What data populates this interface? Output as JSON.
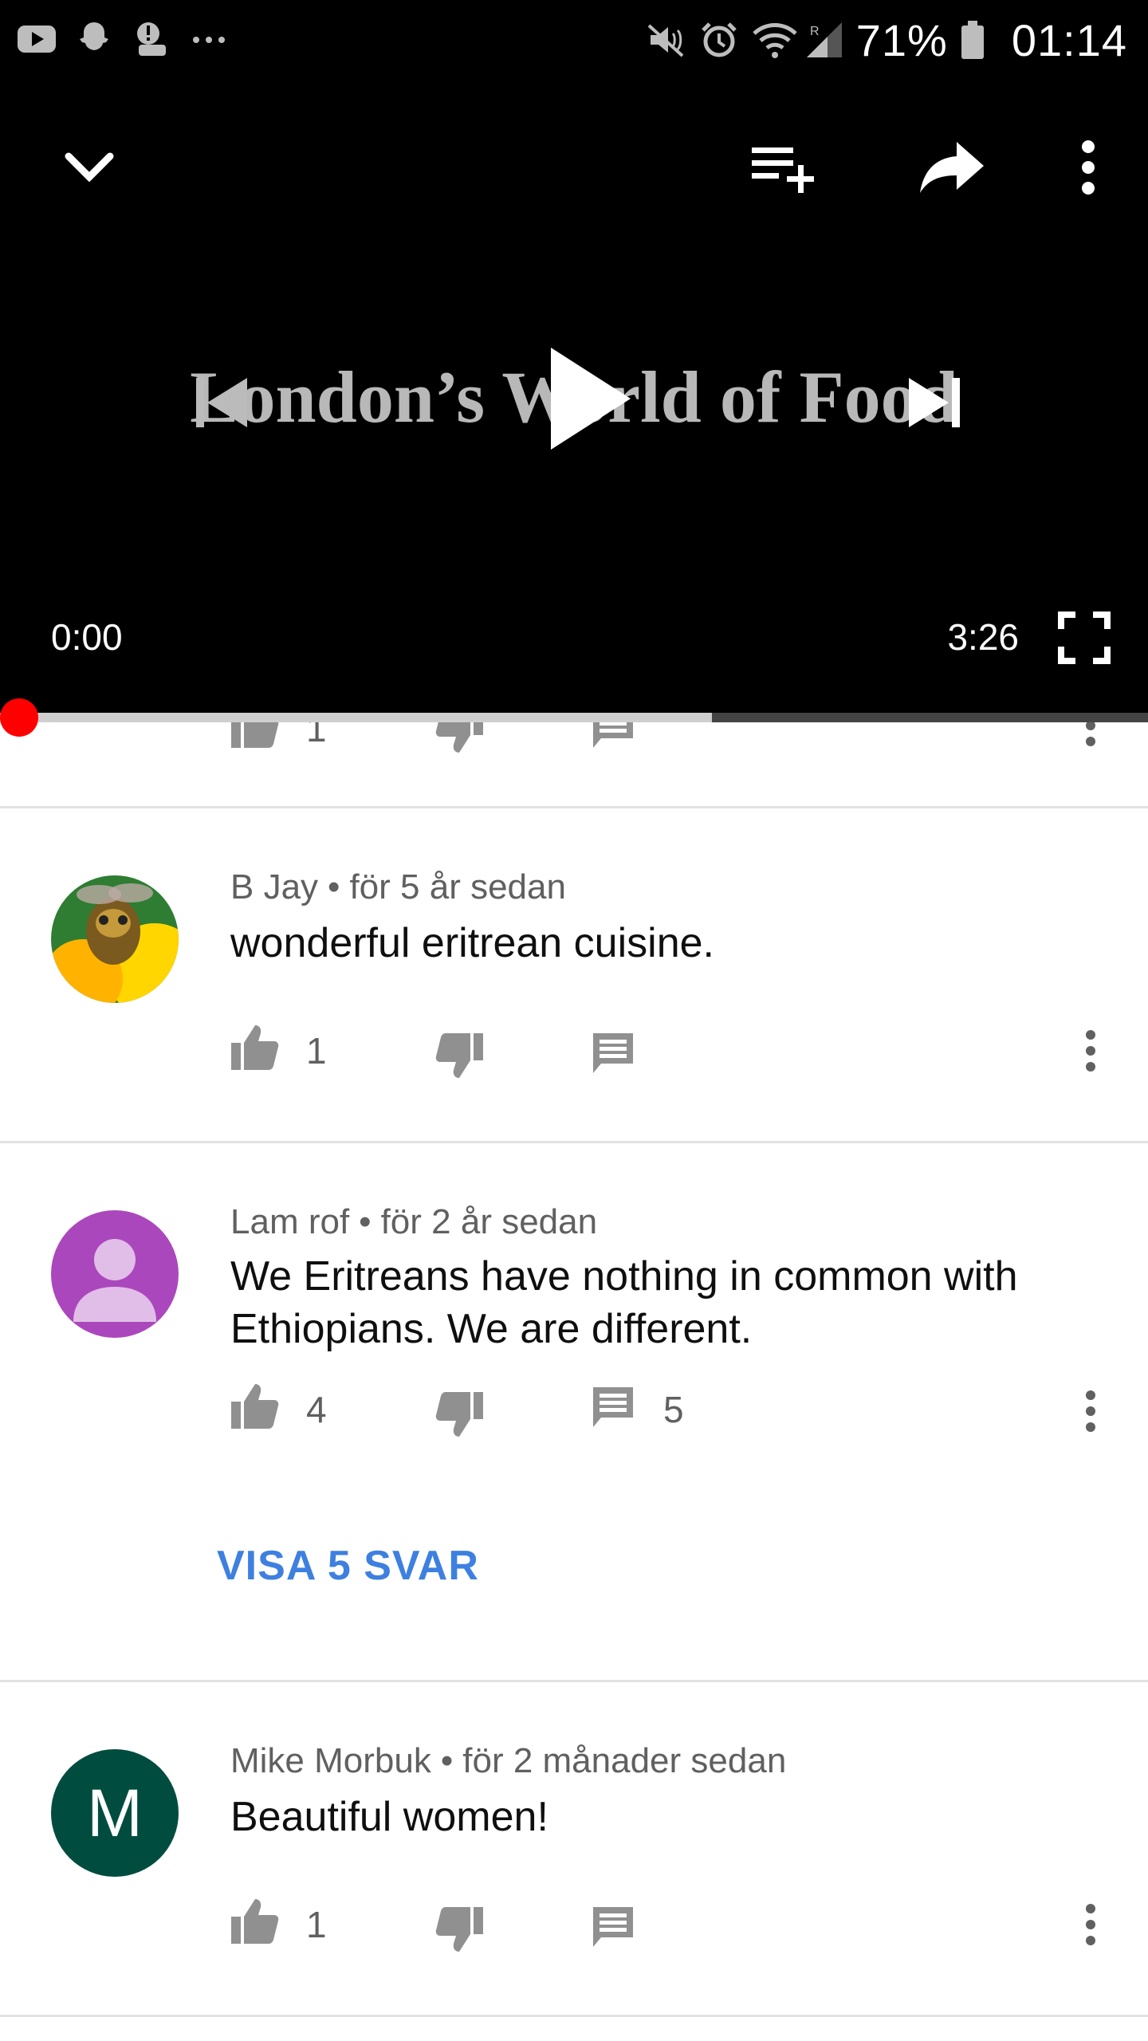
{
  "status_bar": {
    "left_icons": [
      "youtube-icon",
      "snapchat-icon",
      "notification-alert-icon",
      "more-notifications-icon"
    ],
    "right_icons": [
      "mute-icon",
      "alarm-icon",
      "wifi-icon",
      "signal-icon",
      "battery-icon"
    ],
    "battery": "71%",
    "time": "01:14"
  },
  "player": {
    "video_title_overlay": "London’s World of Food",
    "current_time": "0:00",
    "duration": "3:26",
    "progress_fraction": 0.0,
    "buffer_fraction": 0.62,
    "icons": [
      "collapse-chevron-icon",
      "add-to-queue-icon",
      "share-icon",
      "more-vert-icon",
      "previous-icon",
      "play-icon",
      "next-icon",
      "fullscreen-icon"
    ]
  },
  "comments": [
    {
      "author": "",
      "time": "",
      "text": "",
      "likes": "1",
      "replies_count": "",
      "partial": true
    },
    {
      "author": "B Jay",
      "time": "för 5 år sedan",
      "text": "wonderful eritrean cuisine.",
      "likes": "1",
      "replies_count": "",
      "avatar_type": "photo"
    },
    {
      "author": "Lam rof",
      "time": "för 2 år sedan",
      "text": "We Eritreans have nothing in common with Ethiopians.  We are different.",
      "likes": "4",
      "replies_count": "5",
      "show_replies_label": "VISA 5 SVAR",
      "avatar_type": "default-person",
      "avatar_color": "#ab47bc"
    },
    {
      "author": "Mike Morbuk",
      "time": "för 2 månader sedan",
      "text": "Beautiful women!",
      "likes": "1",
      "replies_count": "",
      "avatar_type": "initial",
      "avatar_initial": "M",
      "avatar_color": "#004d40"
    }
  ],
  "colors": {
    "progress_played": "#ff0000",
    "link_blue": "#3e80e0",
    "icon_gray": "#909090"
  }
}
